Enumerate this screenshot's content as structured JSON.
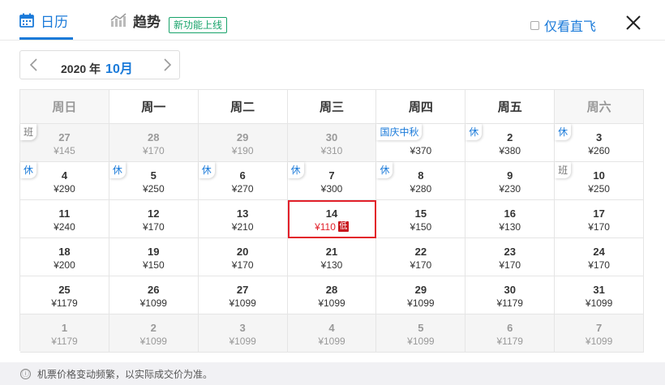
{
  "header": {
    "tab_calendar": "日历",
    "tab_trend": "趋势",
    "new_badge": "新功能上线",
    "direct_only": "仅看直飞",
    "accent_color": "#1a7ad9"
  },
  "month": {
    "year_label": "2020 年",
    "month_label": "10月"
  },
  "weekdays": [
    "周日",
    "周一",
    "周二",
    "周三",
    "周四",
    "周五",
    "周六"
  ],
  "weeks": [
    [
      {
        "day": "27",
        "price": "¥145",
        "tag": "班",
        "tag_type": "work",
        "other": true
      },
      {
        "day": "28",
        "price": "¥170",
        "tag": "",
        "other": true
      },
      {
        "day": "29",
        "price": "¥190",
        "tag": "",
        "other": true
      },
      {
        "day": "30",
        "price": "¥310",
        "tag": "",
        "other": true
      },
      {
        "day": "",
        "price": "¥370",
        "tag": "国庆中秋",
        "tag_type": "holiday",
        "other": false
      },
      {
        "day": "2",
        "price": "¥380",
        "tag": "休",
        "tag_type": "holiday",
        "other": false
      },
      {
        "day": "3",
        "price": "¥260",
        "tag": "休",
        "tag_type": "holiday",
        "other": false
      }
    ],
    [
      {
        "day": "4",
        "price": "¥290",
        "tag": "休",
        "tag_type": "holiday",
        "other": false
      },
      {
        "day": "5",
        "price": "¥250",
        "tag": "休",
        "tag_type": "holiday",
        "other": false
      },
      {
        "day": "6",
        "price": "¥270",
        "tag": "休",
        "tag_type": "holiday",
        "other": false
      },
      {
        "day": "7",
        "price": "¥300",
        "tag": "休",
        "tag_type": "holiday",
        "other": false
      },
      {
        "day": "8",
        "price": "¥280",
        "tag": "休",
        "tag_type": "holiday",
        "other": false
      },
      {
        "day": "9",
        "price": "¥230",
        "tag": "",
        "other": false
      },
      {
        "day": "10",
        "price": "¥250",
        "tag": "班",
        "tag_type": "work",
        "other": false
      }
    ],
    [
      {
        "day": "11",
        "price": "¥240",
        "tag": "",
        "other": false
      },
      {
        "day": "12",
        "price": "¥170",
        "tag": "",
        "other": false
      },
      {
        "day": "13",
        "price": "¥210",
        "tag": "",
        "other": false
      },
      {
        "day": "14",
        "price": "¥110",
        "tag": "",
        "other": false,
        "selected": true,
        "low": "低"
      },
      {
        "day": "15",
        "price": "¥150",
        "tag": "",
        "other": false
      },
      {
        "day": "16",
        "price": "¥130",
        "tag": "",
        "other": false
      },
      {
        "day": "17",
        "price": "¥170",
        "tag": "",
        "other": false
      }
    ],
    [
      {
        "day": "18",
        "price": "¥200",
        "tag": "",
        "other": false
      },
      {
        "day": "19",
        "price": "¥150",
        "tag": "",
        "other": false
      },
      {
        "day": "20",
        "price": "¥170",
        "tag": "",
        "other": false
      },
      {
        "day": "21",
        "price": "¥130",
        "tag": "",
        "other": false
      },
      {
        "day": "22",
        "price": "¥170",
        "tag": "",
        "other": false
      },
      {
        "day": "23",
        "price": "¥170",
        "tag": "",
        "other": false
      },
      {
        "day": "24",
        "price": "¥170",
        "tag": "",
        "other": false
      }
    ],
    [
      {
        "day": "25",
        "price": "¥1179",
        "tag": "",
        "other": false
      },
      {
        "day": "26",
        "price": "¥1099",
        "tag": "",
        "other": false
      },
      {
        "day": "27",
        "price": "¥1099",
        "tag": "",
        "other": false
      },
      {
        "day": "28",
        "price": "¥1099",
        "tag": "",
        "other": false
      },
      {
        "day": "29",
        "price": "¥1099",
        "tag": "",
        "other": false
      },
      {
        "day": "30",
        "price": "¥1179",
        "tag": "",
        "other": false
      },
      {
        "day": "31",
        "price": "¥1099",
        "tag": "",
        "other": false
      }
    ],
    [
      {
        "day": "1",
        "price": "¥1179",
        "tag": "",
        "other": true
      },
      {
        "day": "2",
        "price": "¥1099",
        "tag": "",
        "other": true
      },
      {
        "day": "3",
        "price": "¥1099",
        "tag": "",
        "other": true
      },
      {
        "day": "4",
        "price": "¥1099",
        "tag": "",
        "other": true
      },
      {
        "day": "5",
        "price": "¥1099",
        "tag": "",
        "other": true
      },
      {
        "day": "6",
        "price": "¥1179",
        "tag": "",
        "other": true
      },
      {
        "day": "7",
        "price": "¥1099",
        "tag": "",
        "other": true
      }
    ]
  ],
  "footer": {
    "info_icon": "ⓘ",
    "notice": "机票价格变动频繁，以实际成交价为准。"
  }
}
